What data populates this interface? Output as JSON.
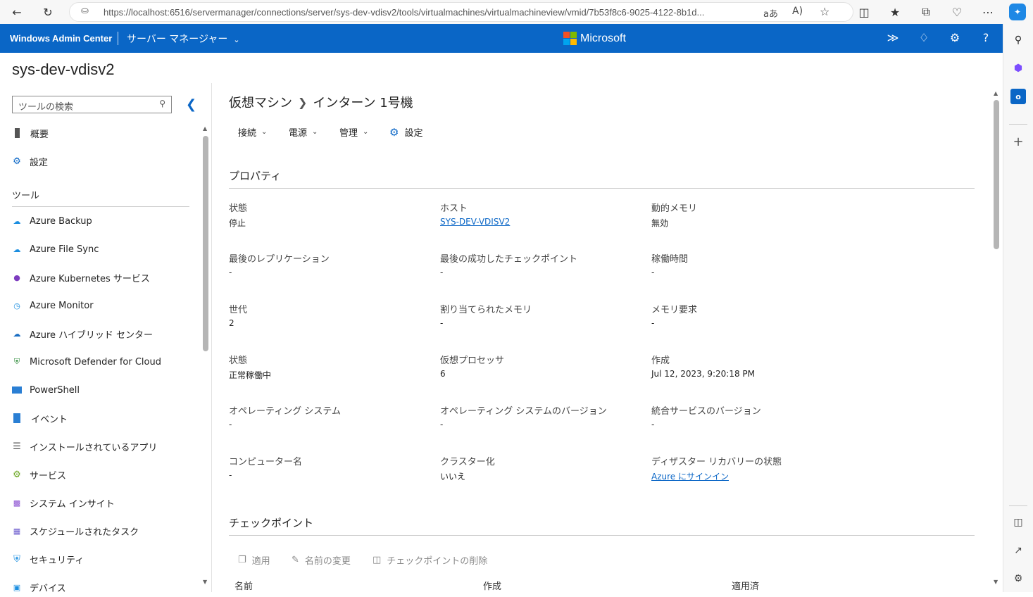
{
  "browser": {
    "url": "https://localhost:6516/servermanager/connections/server/sys-dev-vdisv2/tools/virtualmachines/virtualmachineview/vmid/7b53f8c6-9025-4122-8b1d...",
    "lock_icon": "lock-icon"
  },
  "header": {
    "title": "Windows Admin Center",
    "mode": "サーバー マネージャー",
    "brand": "Microsoft",
    "accent": "#0a66c6"
  },
  "server_name": "sys-dev-vdisv2",
  "nav": {
    "search_placeholder": "ツールの検索",
    "top_items": [
      {
        "label": "概要",
        "icon": "server-icon"
      },
      {
        "label": "設定",
        "icon": "gear-icon"
      }
    ],
    "section_label": "ツール",
    "tools": [
      {
        "label": "Azure Backup",
        "icon": "cloud-backup-icon"
      },
      {
        "label": "Azure File Sync",
        "icon": "cloud-sync-icon"
      },
      {
        "label": "Azure Kubernetes サービス",
        "icon": "kubernetes-icon"
      },
      {
        "label": "Azure Monitor",
        "icon": "monitor-gauge-icon"
      },
      {
        "label": "Azure ハイブリッド センター",
        "icon": "cloud-icon"
      },
      {
        "label": "Microsoft Defender for Cloud",
        "icon": "defender-shield-icon"
      },
      {
        "label": "PowerShell",
        "icon": "powershell-icon"
      },
      {
        "label": "イベント",
        "icon": "event-log-icon"
      },
      {
        "label": "インストールされているアプリ",
        "icon": "list-icon"
      },
      {
        "label": "サービス",
        "icon": "services-gear-icon"
      },
      {
        "label": "システム インサイト",
        "icon": "insights-chart-icon"
      },
      {
        "label": "スケジュールされたタスク",
        "icon": "calendar-icon"
      },
      {
        "label": "セキュリティ",
        "icon": "security-shield-icon"
      },
      {
        "label": "デバイス",
        "icon": "device-icon"
      }
    ]
  },
  "main": {
    "breadcrumb": [
      "仮想マシン",
      "インターン 1号機"
    ],
    "toolbar": {
      "connect": "接続",
      "power": "電源",
      "manage": "管理",
      "settings": "設定"
    },
    "properties_title": "プロパティ",
    "properties": [
      [
        {
          "label": "状態",
          "value": "停止"
        },
        {
          "label": "ホスト",
          "value": "SYS-DEV-VDISV2",
          "link": true
        },
        {
          "label": "動的メモリ",
          "value": "無効"
        }
      ],
      [
        {
          "label": "最後のレプリケーション",
          "value": "-"
        },
        {
          "label": "最後の成功したチェックポイント",
          "value": "-"
        },
        {
          "label": "稼働時間",
          "value": "-"
        }
      ],
      [
        {
          "label": "世代",
          "value": "2"
        },
        {
          "label": "割り当てられたメモリ",
          "value": "-"
        },
        {
          "label": "メモリ要求",
          "value": "-"
        }
      ],
      [
        {
          "label": "状態",
          "value": "正常稼働中"
        },
        {
          "label": "仮想プロセッサ",
          "value": "6"
        },
        {
          "label": "作成",
          "value": "Jul 12, 2023, 9:20:18 PM"
        }
      ],
      [
        {
          "label": "オペレーティング システム",
          "value": "-"
        },
        {
          "label": "オペレーティング システムのバージョン",
          "value": "-"
        },
        {
          "label": "統合サービスのバージョン",
          "value": "-"
        }
      ],
      [
        {
          "label": "コンピューター名",
          "value": "-"
        },
        {
          "label": "クラスター化",
          "value": "いいえ"
        },
        {
          "label": "ディザスター リカバリーの状態",
          "value": "Azure にサインイン",
          "link": true
        }
      ]
    ],
    "checkpoints_title": "チェックポイント",
    "checkpoint_actions": {
      "apply": "適用",
      "rename": "名前の変更",
      "delete": "チェックポイントの削除"
    },
    "checkpoint_columns": [
      "名前",
      "作成",
      "適用済"
    ]
  }
}
